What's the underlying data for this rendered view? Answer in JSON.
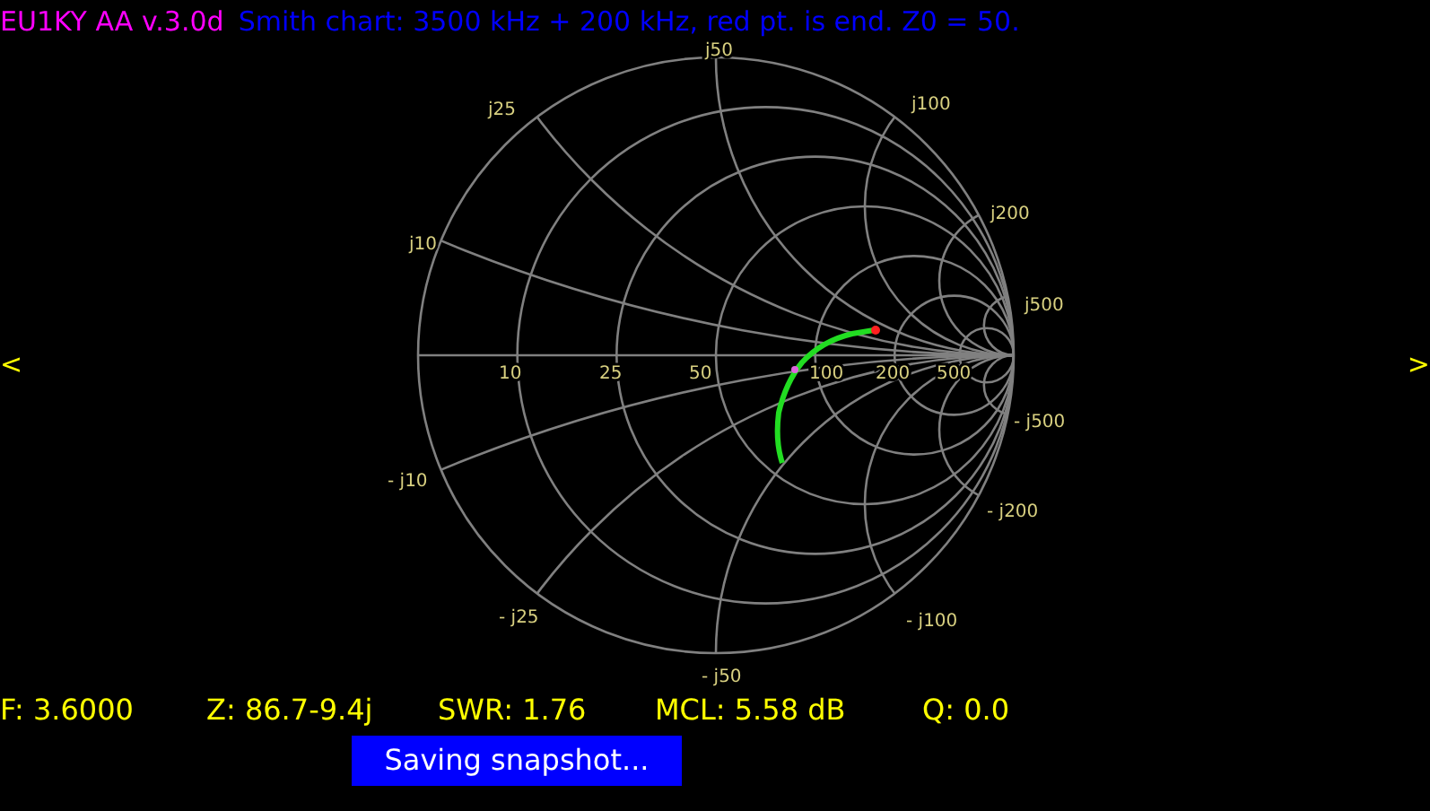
{
  "header": {
    "title": "EU1KY AA v.3.0d",
    "subtitle": "Smith chart: 3500 kHz + 200 kHz, red pt. is end. Z0 = 50."
  },
  "nav": {
    "prev": "<",
    "next": ">"
  },
  "smith_chart": {
    "resistance_labels": [
      "10",
      "25",
      "50",
      "100",
      "200",
      "500"
    ],
    "reactance_labels": [
      "j10",
      "j25",
      "j50",
      "j100",
      "j200",
      "j500"
    ],
    "negative_reactance_labels": [
      "- j10",
      "- j25",
      "- j50",
      "- j100",
      "- j200",
      "- j500"
    ]
  },
  "readings": [
    "F: 3.6000",
    "Z: 86.7-9.4j",
    "SWR: 1.76",
    "MCL: 5.58 dB",
    "Q: 0.0"
  ],
  "status": "Saving snapshot..."
}
